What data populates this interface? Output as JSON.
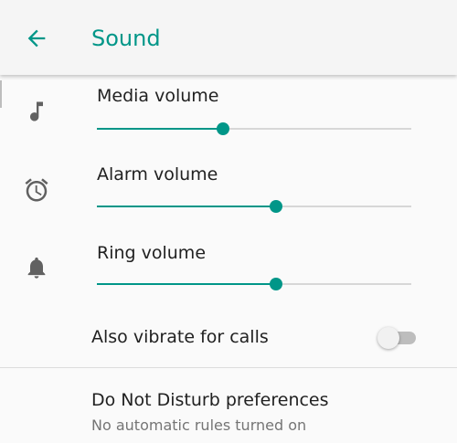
{
  "header": {
    "title": "Sound"
  },
  "sliders": [
    {
      "label": "Media volume",
      "value": 0.4,
      "icon": "music-note-icon"
    },
    {
      "label": "Alarm volume",
      "value": 0.57,
      "icon": "alarm-clock-icon"
    },
    {
      "label": "Ring volume",
      "value": 0.57,
      "icon": "bell-icon"
    }
  ],
  "vibrate": {
    "label": "Also vibrate for calls",
    "enabled": false
  },
  "dnd": {
    "title": "Do Not Disturb preferences",
    "summary": "No automatic rules turned on"
  },
  "colors": {
    "accent": "#009688",
    "icon": "#616161",
    "text_primary": "#212121",
    "text_secondary": "#757575"
  }
}
